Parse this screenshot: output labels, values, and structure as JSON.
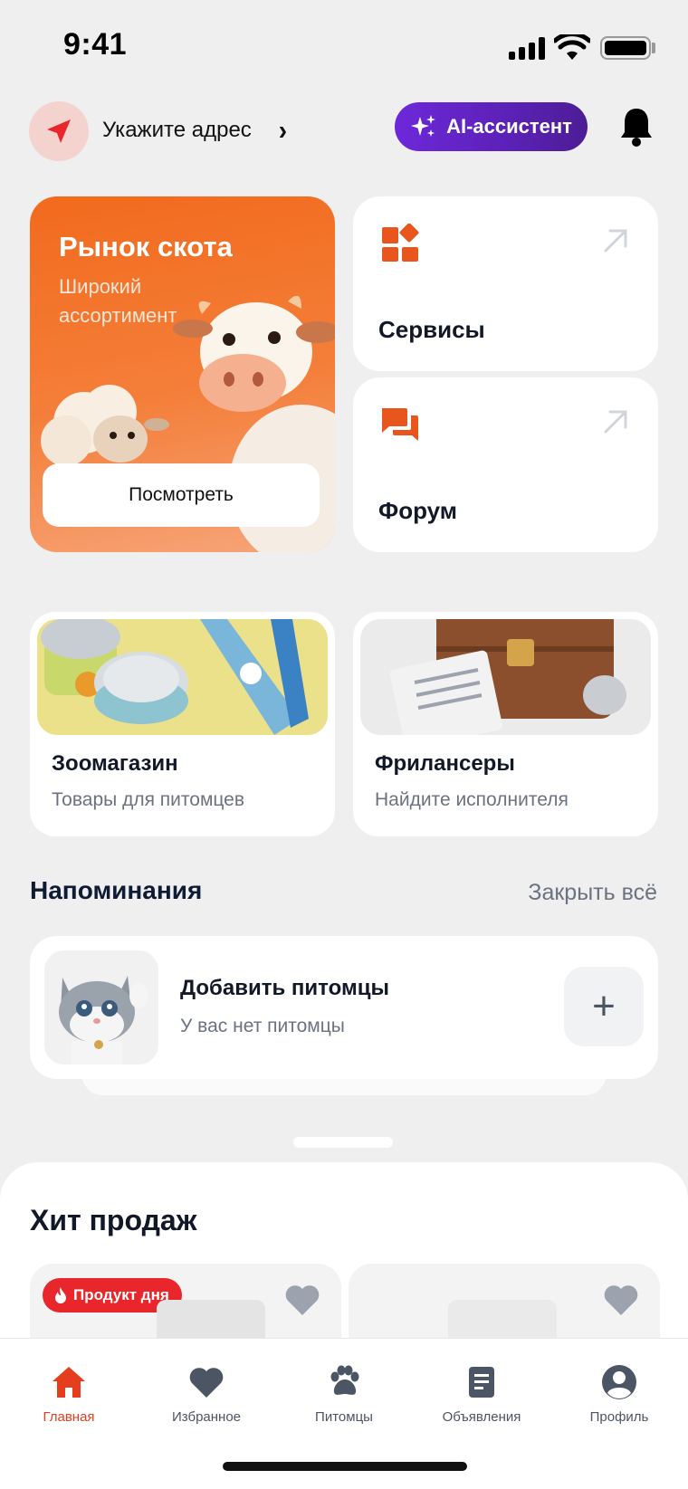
{
  "status_bar": {
    "time": "9:41"
  },
  "header": {
    "address_label": "Укажите адрес",
    "ai_button_label": "AI-ассистент"
  },
  "livestock": {
    "title": "Рынок скота",
    "subtitle": "Широкий ассортимент",
    "button_label": "Посмотреть"
  },
  "tiles": {
    "services": "Сервисы",
    "forum": "Форум"
  },
  "cards": [
    {
      "title": "Зоомагазин",
      "subtitle": "Товары для питомцев"
    },
    {
      "title": "Фрилансеры",
      "subtitle": "Найдите исполнителя"
    }
  ],
  "reminders": {
    "heading": "Напоминания",
    "close_all": "Закрыть всё",
    "item_title": "Добавить питомцы",
    "item_subtitle": "У вас нет питомцы",
    "add_symbol": "+"
  },
  "bestsellers": {
    "heading": "Хит продаж",
    "badge": "Продукт дня"
  },
  "tabbar": {
    "items": [
      {
        "label": "Главная",
        "icon": "home-icon",
        "active": true
      },
      {
        "label": "Избранное",
        "icon": "heart-icon",
        "active": false
      },
      {
        "label": "Питомцы",
        "icon": "paw-icon",
        "active": false
      },
      {
        "label": "Объявления",
        "icon": "document-icon",
        "active": false
      },
      {
        "label": "Профиль",
        "icon": "user-icon",
        "active": false
      }
    ]
  },
  "colors": {
    "accent": "#e53e1e",
    "livestock_card": "#f26a1d",
    "ai_button": "#6d28d9",
    "badge": "#e8262b"
  }
}
